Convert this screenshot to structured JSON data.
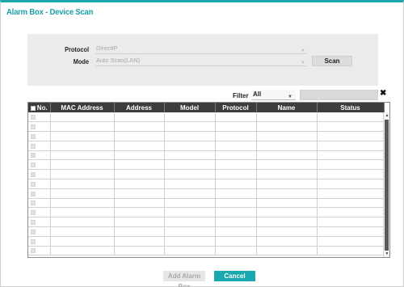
{
  "dialog": {
    "title": "Alarm Box - Device Scan"
  },
  "scan": {
    "protocol_label": "Protocol",
    "protocol_value": "DirectIP",
    "mode_label": "Mode",
    "mode_value": "Auto Scan(LAN)",
    "scan_button": "Scan"
  },
  "filter": {
    "label": "Filter",
    "value": "All",
    "search_value": "",
    "clear_icon": "close-icon"
  },
  "table": {
    "columns": [
      "No.",
      "MAC Address",
      "Address",
      "Model",
      "Protocol",
      "Name",
      "Status"
    ],
    "row_count": 15
  },
  "footer": {
    "add_button": "Add Alarm Box",
    "cancel_button": "Cancel"
  },
  "colors": {
    "accent": "#1ba7ad",
    "header_bg": "#3d3d3d",
    "panel_bg": "#ebebeb",
    "disabled_text": "#aaaaaa"
  }
}
